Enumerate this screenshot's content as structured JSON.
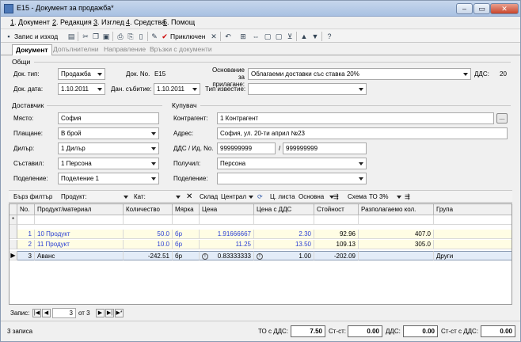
{
  "window": {
    "title": "E15 - Документ за продажба*",
    "controls": [
      "–",
      "▭",
      "✕"
    ]
  },
  "menu": [
    {
      "key": "1",
      "label": "Документ"
    },
    {
      "key": "2",
      "label": "Редакция"
    },
    {
      "key": "3",
      "label": "Изглед"
    },
    {
      "key": "4",
      "label": "Средства"
    },
    {
      "key": "5",
      "label": "Помощ"
    }
  ],
  "toolbar": {
    "save_label": "Запис и изход",
    "apply_label": "Приключен"
  },
  "tabs": [
    {
      "label": "Документ",
      "active": true
    },
    {
      "label": "Допълнителни",
      "active": false
    },
    {
      "label": "Направление",
      "active": false
    },
    {
      "label": "Връзки с документи",
      "active": false
    }
  ],
  "general": {
    "title": "Общи",
    "doc_type_label": "Док. тип:",
    "doc_type_value": "Продажба",
    "doc_no_label": "Док. No.",
    "doc_no_value": "E15",
    "basis_label": "Основание за прилагане:",
    "basis_value": "Облагаеми доставки със ставка 20%",
    "vat_label": "ДДС:",
    "vat_value": "20",
    "doc_date_label": "Док. дата:",
    "doc_date_value": "1.10.2011",
    "tax_event_label": "Дан. събитие:",
    "tax_event_value": "1.10.2011",
    "notice_type_label": "Тип известие:",
    "notice_type_value": ""
  },
  "supplier": {
    "title": "Доставчик",
    "place_label": "Място:",
    "place_value": "София",
    "payment_label": "Плащане:",
    "payment_value": "В брой",
    "dealer_label": "Дилър:",
    "dealer_value": "1 Дилър",
    "composer_label": "Съставил:",
    "composer_value": "1 Персона",
    "division_label": "Поделение:",
    "division_value": "Поделение 1"
  },
  "buyer": {
    "title": "Купувач",
    "contractor_label": "Контрагент:",
    "contractor_value": "1 Контрагент",
    "address_label": "Адрес:",
    "address_value": "София, ул. 20-ти април №23",
    "vat_id_label": "ДДС / Ид. No.",
    "vat_no_value": "999999999",
    "vat_sep": "/",
    "id_no_value": "999999999",
    "received_label": "Получил:",
    "received_value": "Персона",
    "division_label": "Поделение:",
    "division_value": ""
  },
  "filter": {
    "quick_filter_label": "Бърз филтър",
    "product_label": "Продукт:",
    "category_label": "Кат:",
    "warehouse_label": "Склад",
    "warehouse_value": "Централ",
    "price_list_label": "Ц. листа",
    "price_list_value": "Основна",
    "scheme_label": "Схема",
    "scheme_value": "ТО 3%"
  },
  "grid": {
    "columns": [
      "No.",
      "Продукт/материал",
      "Количество",
      "Мярка",
      "Цена",
      "Цена с ДДС",
      "Стойност",
      "Разполагаемо кол.",
      "Група"
    ],
    "new_row_marker": "*",
    "rows": [
      {
        "no": "1",
        "product": "10 Продукт",
        "qty": "50.0",
        "unit": "бр",
        "price": "1.91666667",
        "price_vat": "2.30",
        "value": "92.96",
        "available": "407.0",
        "group": "",
        "style": "yellow"
      },
      {
        "no": "2",
        "product": "11 Продукт",
        "qty": "10.0",
        "unit": "бр",
        "price": "11.25",
        "price_vat": "13.50",
        "value": "109.13",
        "available": "305.0",
        "group": "",
        "style": "yellow"
      },
      {
        "no": "3",
        "product": "Аванс",
        "qty": "-242.51",
        "unit": "бр",
        "price": "0.83333333",
        "price_vat": "1.00",
        "value": "-202.09",
        "available": "",
        "group": "Други",
        "style": "selected"
      }
    ]
  },
  "navigator": {
    "record_label": "Запис:",
    "current": "3",
    "of_label": "от 3"
  },
  "status": {
    "records": "3 записа",
    "to_vat_label": "ТО с ДДС:",
    "to_vat_value": "7.50",
    "st_st_label": "Ст-ст:",
    "st_st_value": "0.00",
    "vat_label": "ДДС:",
    "vat_value": "0.00",
    "st_st_vat_label": "Ст-ст с ДДС:",
    "st_st_vat_value": "0.00"
  }
}
